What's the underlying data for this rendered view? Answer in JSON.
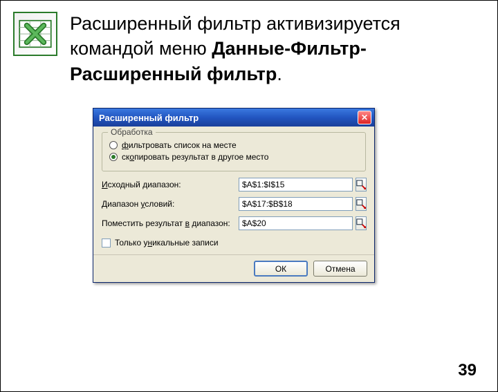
{
  "slide": {
    "text_plain": "Расширенный фильтр активизируется командой  меню ",
    "text_bold1": "Данные-Фильтр-Расширенный фильтр",
    "text_end": ".",
    "page_number": "39"
  },
  "dialog": {
    "title": "Расширенный фильтр",
    "group_label": "Обработка",
    "radio1_pre": "",
    "radio1_u": "ф",
    "radio1_post": "ильтровать список на месте",
    "radio2_pre": "ск",
    "radio2_u": "о",
    "radio2_post": "пировать результат в другое место",
    "selected_radio": 2,
    "field1_label_pre": "",
    "field1_label_u": "И",
    "field1_label_post": "сходный диапазон:",
    "field1_value": "$A$1:$I$15",
    "field2_label_pre": "Диапазон ",
    "field2_label_u": "у",
    "field2_label_post": "словий:",
    "field2_value": "$A$17:$B$18",
    "field3_label_pre": "Поместить результат ",
    "field3_label_u": "в",
    "field3_label_post": " диапазон:",
    "field3_value": "$A$20",
    "check_label_pre": "Только у",
    "check_label_u": "н",
    "check_label_post": "икальные записи",
    "ok_label": "ОК",
    "cancel_label": "Отмена"
  }
}
